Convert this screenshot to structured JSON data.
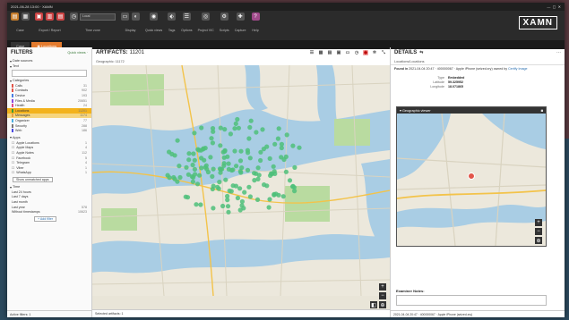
{
  "window": {
    "title": "2021-06-28 13:00 · XAMN"
  },
  "ribbon": {
    "groups": [
      {
        "label": "Case"
      },
      {
        "label": "Export / Report"
      },
      {
        "label": "Time zone",
        "select": "Local"
      },
      {
        "label": "Display"
      },
      {
        "label": "Quick views"
      },
      {
        "label": "Tags"
      },
      {
        "label": "Options"
      },
      {
        "label": "Project VIC"
      },
      {
        "label": "Scripts"
      },
      {
        "label": "Capture"
      },
      {
        "label": "Help"
      }
    ],
    "logo": "XAMN"
  },
  "tabs": [
    {
      "label": "Case"
    },
    {
      "label": "Locations"
    }
  ],
  "filters": {
    "title": "FILTERS",
    "quick_views": "Quick views ·",
    "date_sources": "Date sources",
    "text_label": "Text",
    "categories_label": "Categories",
    "categories": [
      {
        "name": "Calls",
        "count": "31",
        "color": "#e2564a"
      },
      {
        "name": "Contacts",
        "count": "902",
        "color": "#e2564a"
      },
      {
        "name": "Device",
        "count": "193",
        "color": "#4a7fe2"
      },
      {
        "name": "Files & Media",
        "count": "20651",
        "color": "#8a4ae2"
      },
      {
        "name": "Health",
        "count": "24",
        "color": "#e24a8a"
      },
      {
        "name": "Locations",
        "count": "11201",
        "color": "#3a9a3a"
      },
      {
        "name": "Messages",
        "count": "1174",
        "color": "#e2a04a"
      },
      {
        "name": "Organizer",
        "count": "77",
        "color": "#4ab0e2"
      },
      {
        "name": "Security",
        "count": "288",
        "color": "#777777"
      },
      {
        "name": "Web",
        "count": "186",
        "color": "#4a4ae2"
      }
    ],
    "apps_label": "Apps",
    "apps": [
      {
        "name": "Apple Locations",
        "count": "1"
      },
      {
        "name": "Apple Maps",
        "count": "4"
      },
      {
        "name": "Apple Notes",
        "count": "112"
      },
      {
        "name": "Facebook",
        "count": "5"
      },
      {
        "name": "Telegram",
        "count": "4"
      },
      {
        "name": "Viber",
        "count": "1"
      },
      {
        "name": "WhatsApp",
        "count": "1"
      }
    ],
    "show_unmatched": "Show unmatched apps",
    "time_label": "Time",
    "time_rows": [
      {
        "name": "Last 24 hours",
        "count": ""
      },
      {
        "name": "Last 7 days",
        "count": ""
      },
      {
        "name": "Last month",
        "count": ""
      },
      {
        "name": "Last year",
        "count": "578"
      },
      {
        "name": "Without timestamps",
        "count": "10623"
      }
    ],
    "add_filter": "+ Add filter",
    "bottom": "Active filters: 1"
  },
  "artifacts": {
    "title": "ARTIFACTS:",
    "count": "11201",
    "subhead": "Geographic: 11172",
    "bottom": "Selected artifacts: 1"
  },
  "details": {
    "title": "DETAILS",
    "subhead": "Locations/Locations",
    "found_prefix": "Found in",
    "found_text": "2021-04-04 20:47 · 400000067 · Apple iPhone (seized.xry)",
    "found_by": "owned by",
    "found_link": "Certify Image",
    "fields": [
      {
        "k": "Type",
        "v": "Embedded"
      },
      {
        "k": "Latitude",
        "v": "59.325952"
      },
      {
        "k": "Longitude",
        "v": "18.071865"
      }
    ],
    "geo_title": "Geographic viewer",
    "notes_label": "Examiner Notes:",
    "bottom": "2021-04-04 20:47 · 400000067 · Apple iPhone (seized.xry)"
  },
  "colors": {
    "accent": "#e37b2e",
    "water": "#a9cde4",
    "park": "#b9dba0",
    "marker": "#4fbf7a"
  }
}
